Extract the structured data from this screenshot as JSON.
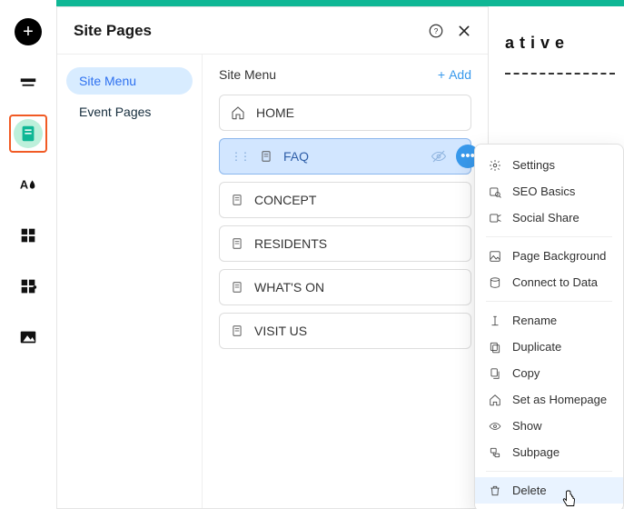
{
  "header": {
    "title": "Site Pages"
  },
  "nav": {
    "items": [
      {
        "label": "Site Menu",
        "active": true
      },
      {
        "label": "Event Pages",
        "active": false
      }
    ]
  },
  "pages": {
    "groupLabel": "Site Menu",
    "addLabel": "Add",
    "items": [
      {
        "label": "HOME",
        "icon": "home"
      },
      {
        "label": "FAQ",
        "icon": "page",
        "selected": true
      },
      {
        "label": "CONCEPT",
        "icon": "page"
      },
      {
        "label": "RESIDENTS",
        "icon": "page"
      },
      {
        "label": "WHAT'S ON",
        "icon": "page"
      },
      {
        "label": "VISIT US",
        "icon": "page"
      }
    ]
  },
  "right": {
    "headingFragment": "ative"
  },
  "menu": {
    "items": [
      {
        "label": "Settings",
        "icon": "gear"
      },
      {
        "label": "SEO Basics",
        "icon": "seo"
      },
      {
        "label": "Social Share",
        "icon": "social"
      },
      {
        "sep": true
      },
      {
        "label": "Page Background",
        "icon": "bg"
      },
      {
        "label": "Connect to Data",
        "icon": "data"
      },
      {
        "sep": true
      },
      {
        "label": "Rename",
        "icon": "rename"
      },
      {
        "label": "Duplicate",
        "icon": "duplicate"
      },
      {
        "label": "Copy",
        "icon": "copy"
      },
      {
        "label": "Set as Homepage",
        "icon": "home"
      },
      {
        "label": "Show",
        "icon": "show"
      },
      {
        "label": "Subpage",
        "icon": "subpage"
      },
      {
        "sep": true
      },
      {
        "label": "Delete",
        "icon": "delete",
        "hovered": true
      }
    ]
  }
}
